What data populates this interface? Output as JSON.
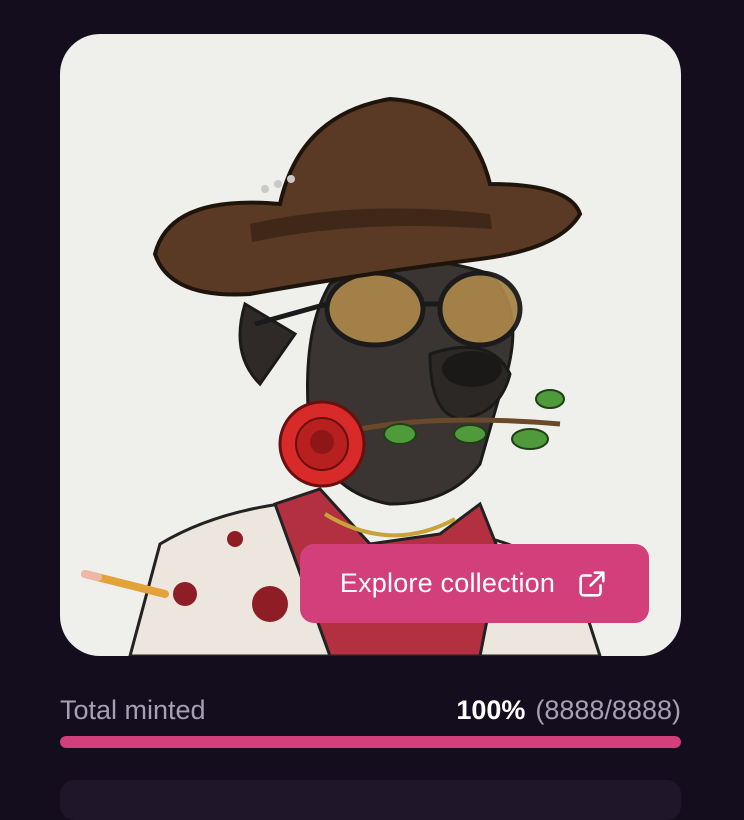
{
  "card": {
    "image_alt": "NFT artwork: dog in cowboy hat with sunglasses holding a rose",
    "background": "#efefec",
    "explore_button": {
      "label": "Explore collection",
      "icon": "external-link-icon"
    }
  },
  "mint_stats": {
    "label": "Total minted",
    "percent_text": "100%",
    "count_text": "(8888/8888)",
    "progress_fraction": 1.0
  },
  "colors": {
    "page_background": "#140d1e",
    "accent": "#d23f7b",
    "muted_text": "#a79fb3"
  }
}
